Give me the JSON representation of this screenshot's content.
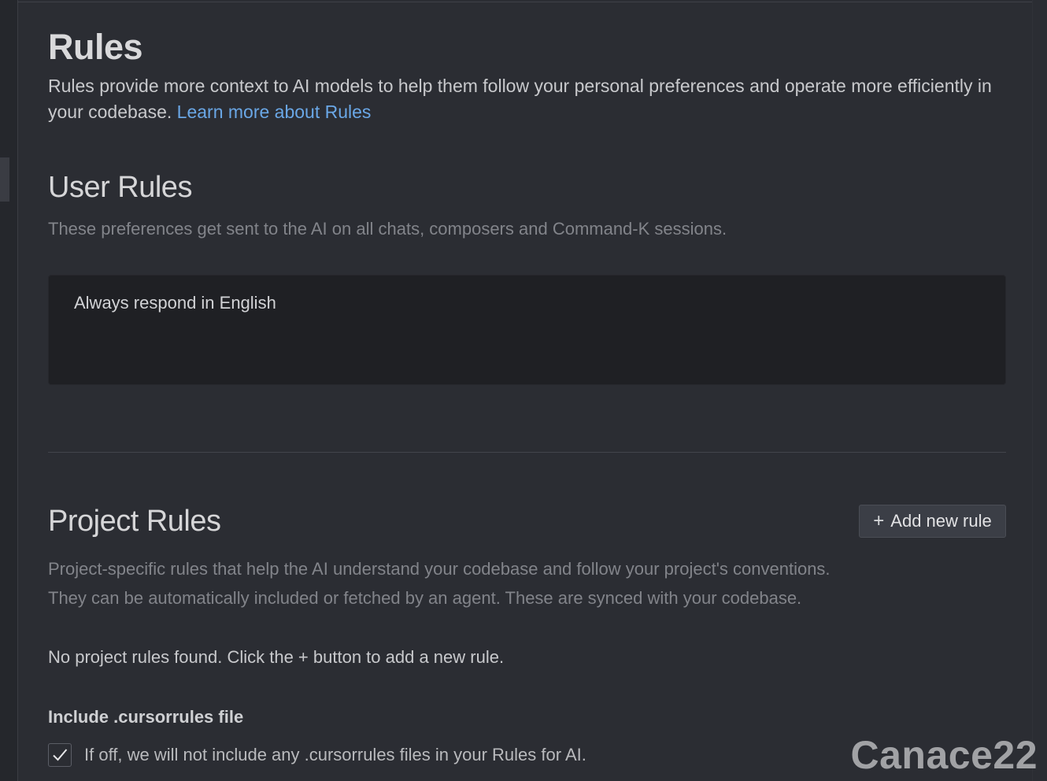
{
  "page": {
    "title": "Rules",
    "description": "Rules provide more context to AI models to help them follow your personal preferences and operate more efficiently in your codebase.",
    "learn_more_link": "Learn more about Rules"
  },
  "user_rules": {
    "title": "User Rules",
    "description": "These preferences get sent to the AI on all chats, composers and Command-K sessions.",
    "rules_text": "Always respond in English"
  },
  "project_rules": {
    "title": "Project Rules",
    "add_button_label": "Add new rule",
    "add_button_icon": "+",
    "description_line1": "Project-specific rules that help the AI understand your codebase and follow your project's conventions.",
    "description_line2": "They can be automatically included or fetched by an agent. These are synced with your codebase.",
    "empty_message": "No project rules found. Click the + button to add a new rule."
  },
  "cursorrules_option": {
    "title": "Include .cursorrules file",
    "checked": true,
    "label": "If off, we will not include any .cursorrules files in your Rules for AI."
  },
  "watermark": "Canace22",
  "colors": {
    "background": "#2b2d33",
    "textarea_background": "#1f2024",
    "link": "#6aa7e6",
    "muted_text": "#82848a"
  }
}
